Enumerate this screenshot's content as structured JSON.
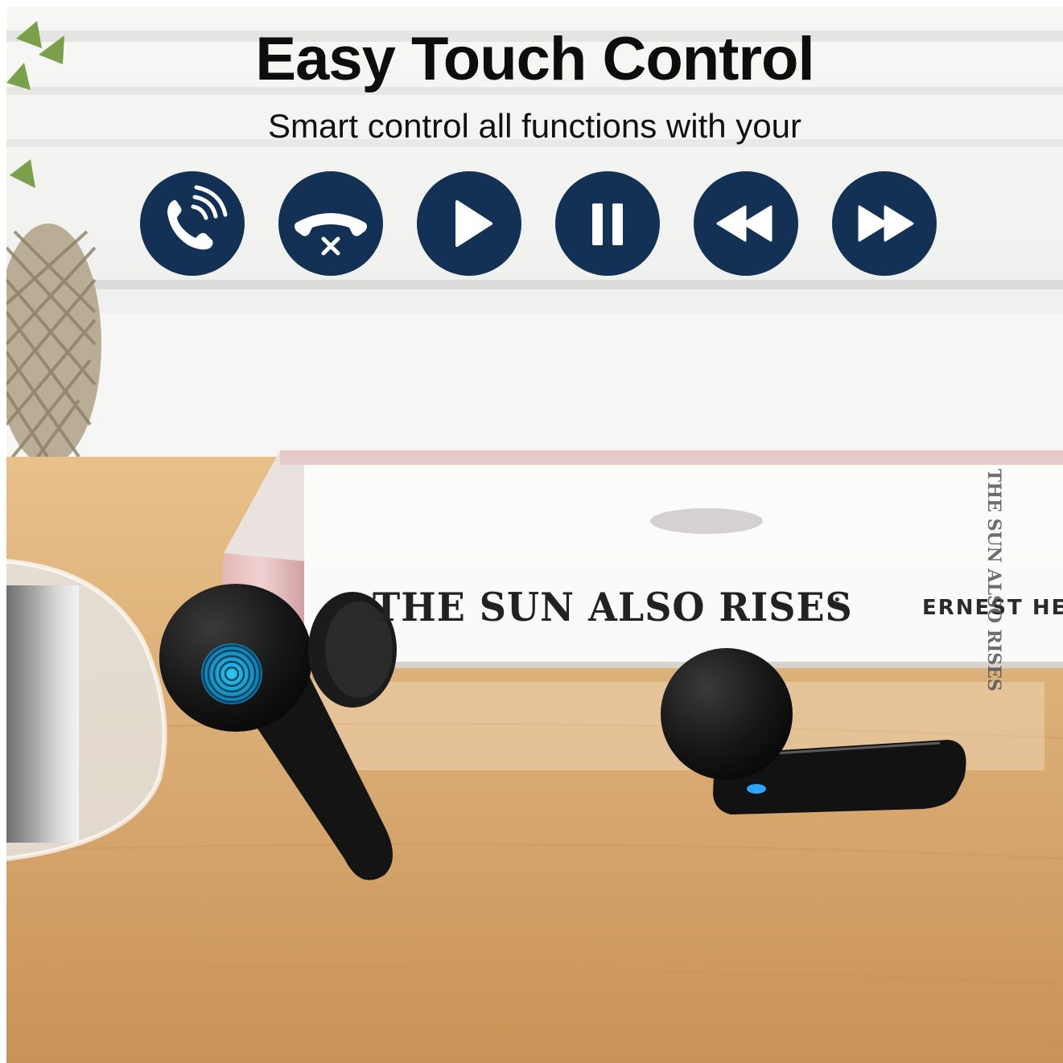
{
  "banner": {
    "title": "Easy Touch Control",
    "subtitle": "Smart control all functions with your"
  },
  "controls": [
    {
      "icon": "phone-answer-icon"
    },
    {
      "icon": "phone-hangup-icon"
    },
    {
      "icon": "play-icon"
    },
    {
      "icon": "pause-icon"
    },
    {
      "icon": "rewind-icon"
    },
    {
      "icon": "fast-forward-icon"
    }
  ],
  "book": {
    "cover_title": "THE SUN ALSO RISES",
    "separator": "•",
    "cover_author": "ERNEST HE",
    "spine_text": "THE SUN ALSO RISES"
  },
  "colors": {
    "control_circle": "#133055",
    "control_glyph": "#ffffff",
    "fingerprint": "#1fb6e6",
    "earbud": "#151515",
    "wood": "#d6a46a"
  }
}
